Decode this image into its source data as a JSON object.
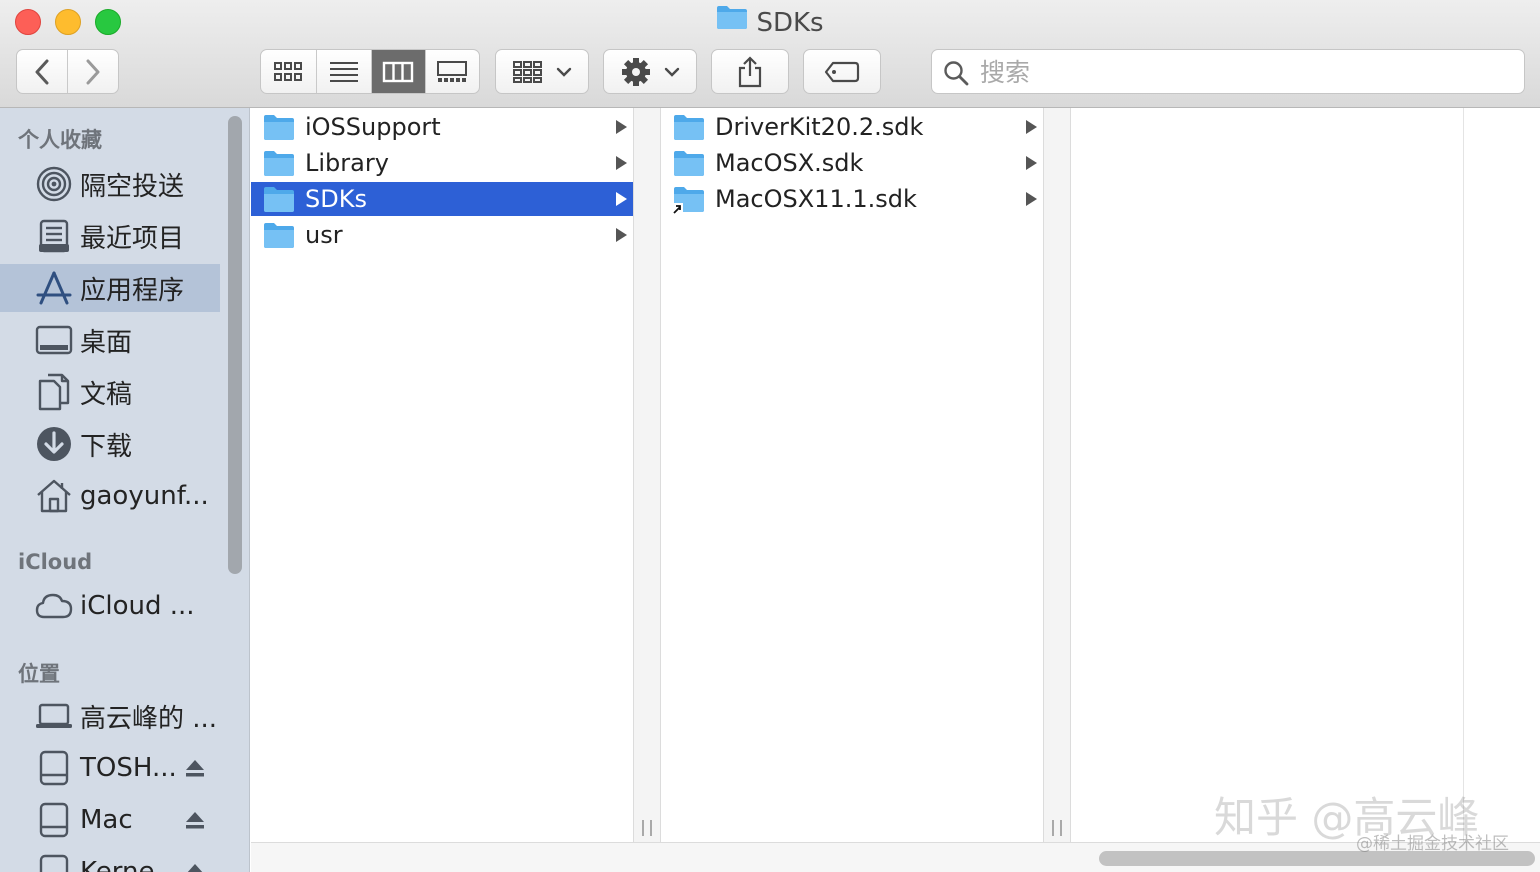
{
  "window": {
    "title": "SDKs"
  },
  "toolbar": {
    "back_icon": "chevron-left-icon",
    "forward_icon": "chevron-right-icon",
    "view_modes": [
      "icon-view-icon",
      "list-view-icon",
      "column-view-icon",
      "gallery-view-icon"
    ],
    "active_view": "column-view-icon",
    "group_icon": "group-by-icon",
    "action_icon": "gear-icon",
    "share_icon": "share-icon",
    "tag_icon": "tag-icon",
    "search": {
      "placeholder": "搜索",
      "value": ""
    }
  },
  "sidebar": {
    "favorites_header": "个人收藏",
    "favorites": [
      {
        "label": "隔空投送",
        "icon": "airdrop-icon"
      },
      {
        "label": "最近项目",
        "icon": "recents-icon"
      },
      {
        "label": "应用程序",
        "icon": "applications-icon",
        "active": true
      },
      {
        "label": "桌面",
        "icon": "desktop-icon"
      },
      {
        "label": "文稿",
        "icon": "documents-icon"
      },
      {
        "label": "下载",
        "icon": "downloads-icon"
      },
      {
        "label": "gaoyunf...",
        "icon": "home-icon"
      }
    ],
    "icloud_header": "iCloud",
    "icloud": [
      {
        "label": "iCloud ...",
        "icon": "cloud-icon"
      }
    ],
    "locations_header": "位置",
    "locations": [
      {
        "label": "高云峰的 ...",
        "icon": "laptop-icon"
      },
      {
        "label": "TOSH...",
        "icon": "disk-icon",
        "eject": true
      },
      {
        "label": "Mac",
        "icon": "disk-icon",
        "eject": true
      },
      {
        "label": "Kerne...",
        "icon": "disk-icon",
        "eject": true
      }
    ]
  },
  "columns": [
    {
      "items": [
        {
          "name": "iOSSupport",
          "icon": "folder-icon"
        },
        {
          "name": "Library",
          "icon": "folder-icon"
        },
        {
          "name": "SDKs",
          "icon": "folder-icon",
          "selected": true
        },
        {
          "name": "usr",
          "icon": "folder-icon"
        }
      ]
    },
    {
      "items": [
        {
          "name": "DriverKit20.2.sdk",
          "icon": "folder-icon"
        },
        {
          "name": "MacOSX.sdk",
          "icon": "folder-icon"
        },
        {
          "name": "MacOSX11.1.sdk",
          "icon": "folder-alias-icon"
        }
      ]
    },
    {
      "items": []
    }
  ],
  "watermark": {
    "main": "知乎 @高云峰",
    "sub": "@稀土掘金技术社区"
  },
  "colors": {
    "selection": "#2d60d6",
    "sidebar_bg": "#d3dbe6",
    "sidebar_active": "#b4c3d8",
    "folder": "#5fb4f0"
  }
}
